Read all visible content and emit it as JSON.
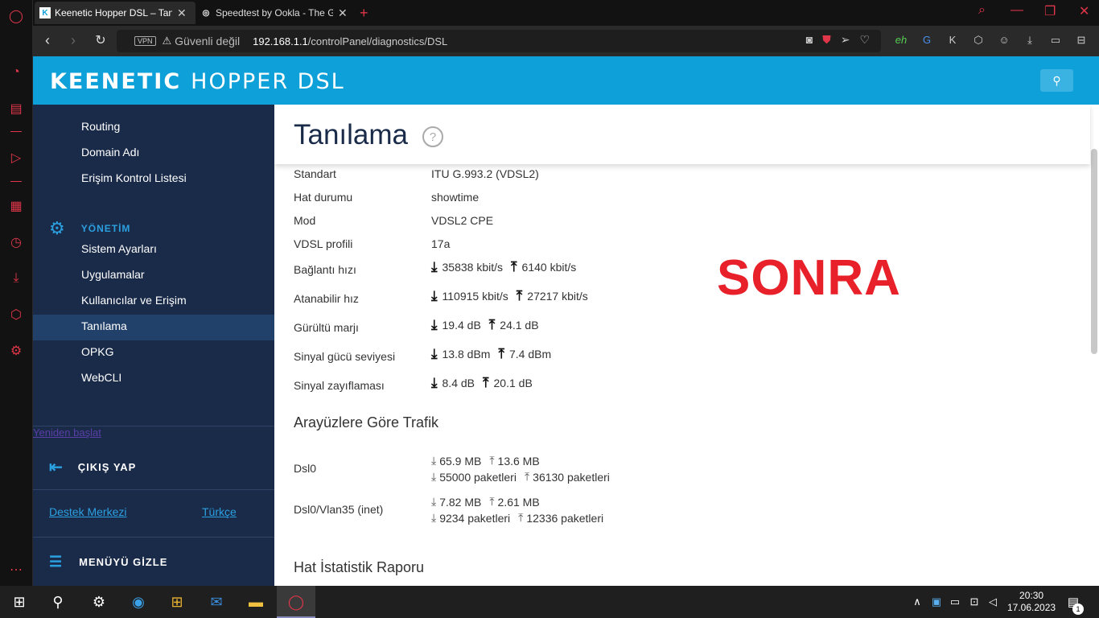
{
  "browser": {
    "tabs": [
      {
        "title": "Keenetic Hopper DSL – Tan",
        "favicon": "K"
      },
      {
        "title": "Speedtest by Ookla - The G",
        "favicon": "◎"
      }
    ],
    "new_tab": "+",
    "vpn": "VPN",
    "security": "Güvenli değil",
    "url_host": "192.168.1.1",
    "url_path": "/controlPanel/diagnostics/DSL"
  },
  "header": {
    "logo_bold": "KEENETIC",
    "logo_light": "HOPPER DSL"
  },
  "nav": {
    "items_top": [
      "Routing",
      "Domain Adı",
      "Erişim Kontrol Listesi"
    ],
    "section": "YÖNETİM",
    "items_admin": [
      "Sistem Ayarları",
      "Uygulamalar",
      "Kullanıcılar ve Erişim",
      "Tanılama",
      "OPKG",
      "WebCLI"
    ],
    "restart": "Yeniden başlat",
    "logout": "ÇIKIŞ YAP",
    "support": "Destek Merkezi",
    "language": "Türkçe",
    "hide_menu": "MENÜYÜ GİZLE"
  },
  "main": {
    "title": "Tanılama",
    "help": "?",
    "rows": {
      "standart": {
        "label": "Standart",
        "value": "ITU G.993.2 (VDSL2)"
      },
      "hat": {
        "label": "Hat durumu",
        "value": "showtime"
      },
      "mod": {
        "label": "Mod",
        "value": "VDSL2 CPE"
      },
      "profil": {
        "label": "VDSL profili",
        "value": "17a"
      },
      "baglanti": {
        "label": "Bağlantı hızı",
        "down": "35838 kbit/s",
        "up": "6140 kbit/s"
      },
      "atanabilir": {
        "label": "Atanabilir hız",
        "down": "110915 kbit/s",
        "up": "27217 kbit/s"
      },
      "gurultu": {
        "label": "Gürültü marjı",
        "down": "19.4 dB",
        "up": "24.1 dB"
      },
      "sinyal": {
        "label": "Sinyal gücü seviyesi",
        "down": "13.8 dBm",
        "up": "7.4 dBm"
      },
      "zayiflama": {
        "label": "Sinyal zayıflaması",
        "down": "8.4 dB",
        "up": "20.1 dB"
      }
    },
    "traffic_title": "Arayüzlere Göre Trafik",
    "traffic": [
      {
        "name": "Dsl0",
        "down_bytes": "65.9 MB",
        "up_bytes": "13.6 MB",
        "down_pkts": "55000 paketleri",
        "up_pkts": "36130 paketleri"
      },
      {
        "name": "Dsl0/Vlan35 (inet)",
        "down_bytes": "7.82 MB",
        "up_bytes": "2.61 MB",
        "down_pkts": "9234 paketleri",
        "up_pkts": "12336 paketleri"
      }
    ],
    "report_title": "Hat İstatistik Raporu",
    "overlay": "SONRA"
  },
  "taskbar": {
    "time": "20:30",
    "date": "17.06.2023",
    "notifications": "1"
  }
}
